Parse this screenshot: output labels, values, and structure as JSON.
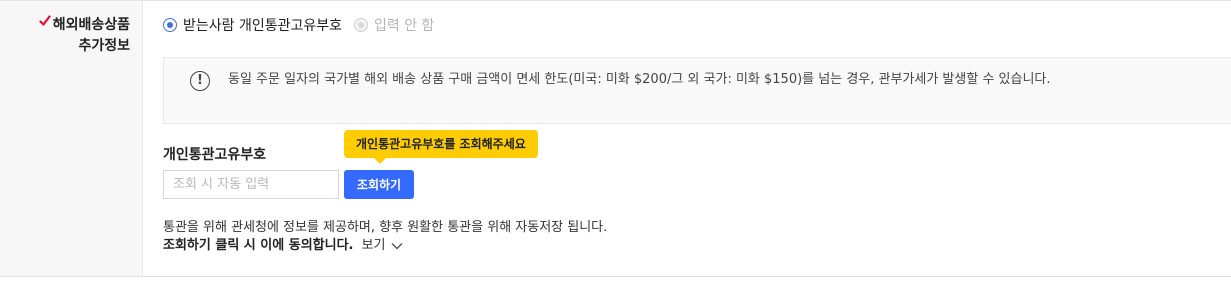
{
  "section": {
    "label_line1": "해외배송상품",
    "label_line2": "추가정보"
  },
  "options": {
    "pcc_label": "받는사람 개인통관고유부호",
    "no_input_label": "입력 안 함",
    "selected": "pcc"
  },
  "notice": {
    "text": "동일 주문 일자의 국가별 해외 배송 상품 구매 금액이 면세 한도(미국: 미화 $200/그 외 국가: 미화 $150)를 넘는 경우, 관부가세가 발생할 수 있습니다."
  },
  "pcc": {
    "title": "개인통관고유부호",
    "tooltip": "개인통관고유부호를 조회해주세요",
    "placeholder": "조회 시 자동 입력",
    "lookup_button": "조회하기"
  },
  "consent": {
    "line1": "통관을 위해 관세청에 정보를 제공하며, 향후 원활한 통관을 위해 자동저장 됩니다.",
    "line2": "조회하기 클릭 시 이에 동의합니다.",
    "view": "보기"
  },
  "colors": {
    "accent": "#346aff",
    "radio": "#3f72d8",
    "tooltip": "#ffcc00",
    "required": "#e0102e"
  },
  "icons": {
    "required": "check-icon",
    "notice": "exclamation-circle-icon",
    "view": "chevron-down-icon"
  }
}
